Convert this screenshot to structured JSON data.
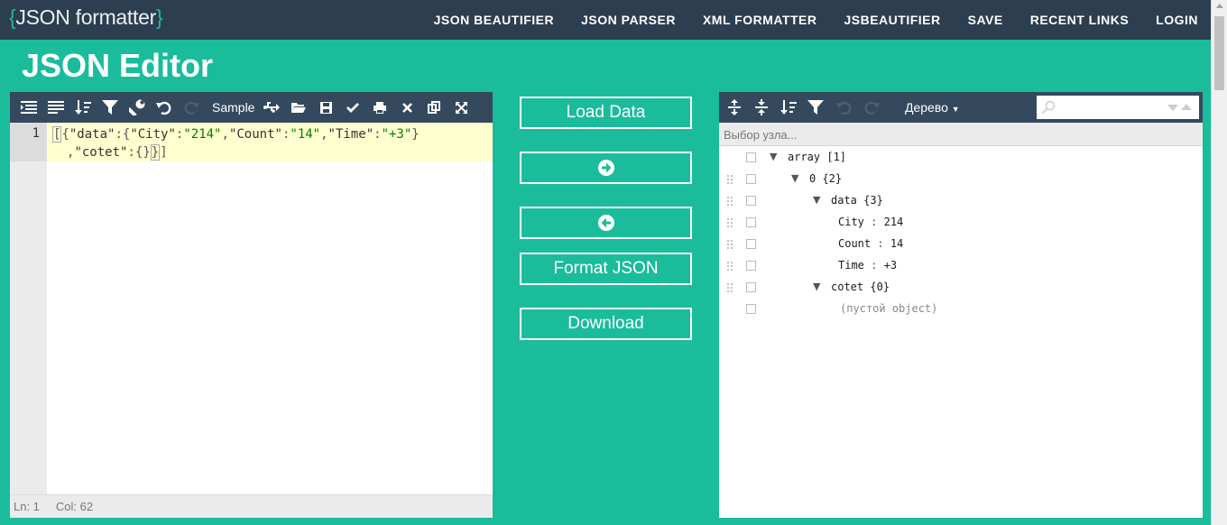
{
  "logo": {
    "open": "{",
    "text": "JSON formatter",
    "close": "}"
  },
  "nav": [
    "JSON BEAUTIFIER",
    "JSON PARSER",
    "XML FORMATTER",
    "JSBEAUTIFIER",
    "SAVE",
    "RECENT LINKS",
    "LOGIN"
  ],
  "page_title": "JSON Editor",
  "editor": {
    "toolbar": {
      "icons": [
        "format-icon",
        "compact-icon",
        "sort-icon",
        "filter-icon",
        "repair-icon",
        "undo-icon",
        "redo-icon"
      ],
      "sample_label": "Sample",
      "right_icons": [
        "usb-icon",
        "open-folder-icon",
        "save-icon",
        "check-icon",
        "print-icon",
        "clear-icon",
        "copy-icon",
        "fullscreen-icon"
      ]
    },
    "line_number": "1",
    "code": {
      "line1_tokens": [
        "[",
        "{",
        "\"data\"",
        ":",
        "{",
        "\"City\"",
        ":",
        "\"214\"",
        ",",
        "\"Count\"",
        ":",
        "\"14\"",
        ",",
        "\"Time\"",
        ":",
        "\"+3\"",
        "}"
      ],
      "line2_tokens": [
        ",",
        "\"cotet\"",
        ":",
        "{",
        "}",
        "}",
        "]"
      ]
    },
    "status": {
      "line": "Ln: 1",
      "col": "Col: 62"
    }
  },
  "middle_buttons": {
    "load": "Load Data",
    "format": "Format JSON",
    "download": "Download"
  },
  "tree": {
    "mode_label": "Дерево",
    "breadcrumb_placeholder": "Выбор узла...",
    "rows": [
      {
        "level": 0,
        "caret": "▼",
        "key": "array",
        "meta": "[1]",
        "grip": false
      },
      {
        "level": 1,
        "caret": "▼",
        "key": "0",
        "meta": "{2}",
        "grip": true
      },
      {
        "level": 2,
        "caret": "▼",
        "key": "data",
        "meta": "{3}",
        "grip": true
      },
      {
        "level": 3,
        "caret": "",
        "key": "City",
        "value": "214",
        "grip": true
      },
      {
        "level": 3,
        "caret": "",
        "key": "Count",
        "value": "14",
        "grip": true
      },
      {
        "level": 3,
        "caret": "",
        "key": "Time",
        "value": "+3",
        "grip": true
      },
      {
        "level": 2,
        "caret": "▼",
        "key": "cotet",
        "meta": "{0}",
        "grip": true
      },
      {
        "level": 3,
        "caret": "",
        "empty": "(пустой object)",
        "grip": false
      }
    ],
    "colon": ":"
  }
}
